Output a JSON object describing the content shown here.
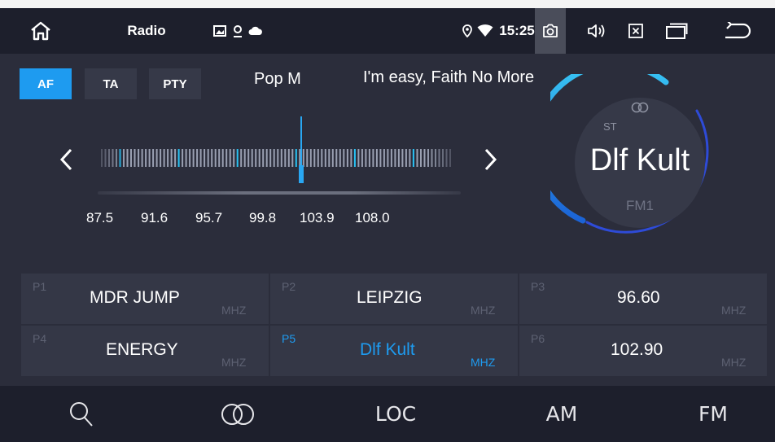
{
  "status_bar": {
    "title": "Radio",
    "time": "15:25",
    "icons": [
      "home-icon",
      "gallery-icon",
      "location-pin-icon",
      "cloud-icon",
      "location-pin-icon",
      "wifi-icon",
      "camera-icon",
      "volume-icon",
      "close-window-icon",
      "recent-apps-icon",
      "back-icon"
    ]
  },
  "rds": {
    "af_label": "AF",
    "ta_label": "TA",
    "pty_label": "PTY",
    "pty_value": "Pop M",
    "radio_text": "I'm easy, Faith No More"
  },
  "tuner": {
    "scale": [
      "87.5",
      "91.6",
      "95.7",
      "99.8",
      "103.9",
      "108.0"
    ],
    "min_mhz": 87.5,
    "max_mhz": 108.0,
    "current_mhz": 99.3
  },
  "dial": {
    "station": "Dlf Kult",
    "stereo_label": "ST",
    "band": "FM1",
    "ring_color": "#29a7f2"
  },
  "presets": [
    {
      "number": "P1",
      "name": "MDR JUMP",
      "unit": "MHZ",
      "active": false
    },
    {
      "number": "P2",
      "name": "LEIPZIG",
      "unit": "MHZ",
      "active": false
    },
    {
      "number": "P3",
      "name": "96.60",
      "unit": "MHZ",
      "active": false
    },
    {
      "number": "P4",
      "name": "ENERGY",
      "unit": "MHZ",
      "active": false
    },
    {
      "number": "P5",
      "name": "Dlf Kult",
      "unit": "MHZ",
      "active": true
    },
    {
      "number": "P6",
      "name": "102.90",
      "unit": "MHZ",
      "active": false
    }
  ],
  "bottom_bar": {
    "loc_label": "LOC",
    "am_label": "AM",
    "fm_label": "FM"
  },
  "colors": {
    "accent": "#1e9bf0",
    "background": "#2b2d3b",
    "bar": "#1d1f2c"
  }
}
